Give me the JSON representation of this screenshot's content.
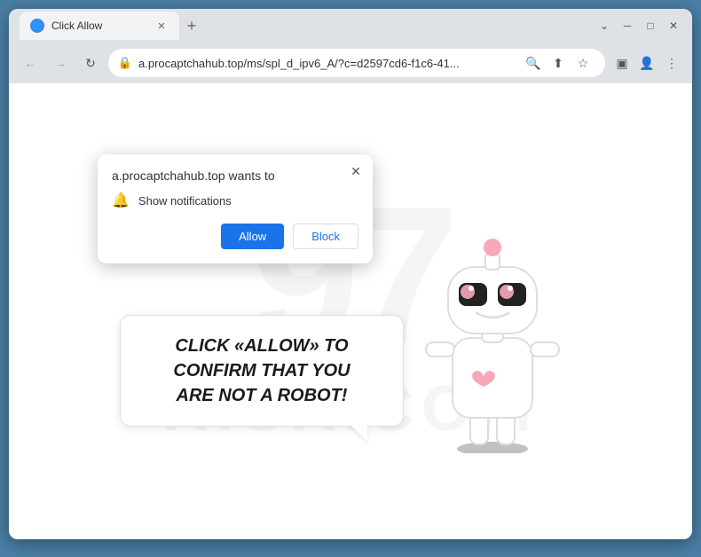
{
  "browser": {
    "title": "Click Allow",
    "tab": {
      "label": "Click Allow",
      "favicon": "🌐"
    },
    "new_tab_label": "+",
    "address_bar": {
      "url": "a.procaptchahub.top/ms/spl_d_ipv6_A/?c=d2597cd6-f1c6-41...",
      "lock_icon": "🔒"
    },
    "nav": {
      "back": "←",
      "forward": "→",
      "refresh": "↻"
    },
    "window_controls": {
      "minimize": "─",
      "maximize": "□",
      "close": "✕",
      "chevron": "⌄"
    }
  },
  "notification_popup": {
    "title": "a.procaptchahub.top wants to",
    "permission_label": "Show notifications",
    "allow_button": "Allow",
    "block_button": "Block",
    "close_icon": "✕"
  },
  "page": {
    "captcha_text_line1": "CLICK «ALLOW» TO CONFIRM THAT YOU",
    "captcha_text_line2": "ARE NOT A ROBOT!",
    "watermark_number": "97",
    "watermark_text": "RISK.COM"
  },
  "icons": {
    "bell": "🔔",
    "search": "🔍",
    "share": "⬆",
    "star": "☆",
    "extensions": "▣",
    "profile": "👤",
    "menu": "⋮"
  }
}
